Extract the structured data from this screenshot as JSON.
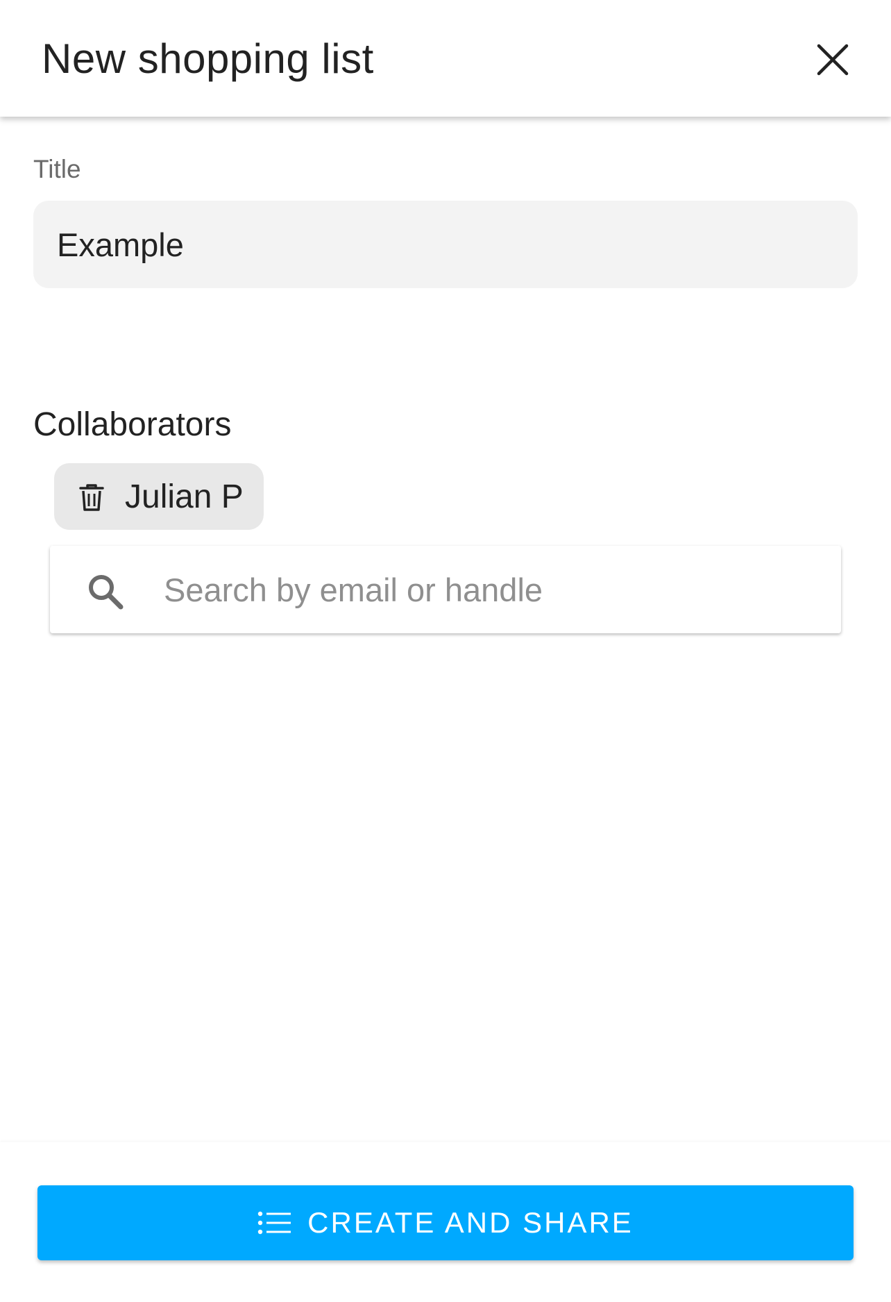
{
  "header": {
    "title": "New shopping list",
    "close_icon": "close-icon"
  },
  "title_field": {
    "label": "Title",
    "value": "Example"
  },
  "collaborators": {
    "heading": "Collaborators",
    "chips": [
      {
        "label": "Julian P",
        "icon": "trash-icon"
      }
    ],
    "search": {
      "placeholder": "Search by email or handle",
      "value": "",
      "icon": "search-icon"
    }
  },
  "footer": {
    "primary_button_label": "CREATE AND SHARE",
    "primary_button_icon": "list-icon"
  },
  "colors": {
    "accent": "#00a9ff",
    "input_background": "#f3f3f3",
    "chip_background": "#e8e8e8",
    "text": "#222222",
    "muted_text": "#6b6b6b",
    "placeholder": "#8f8f8f"
  }
}
